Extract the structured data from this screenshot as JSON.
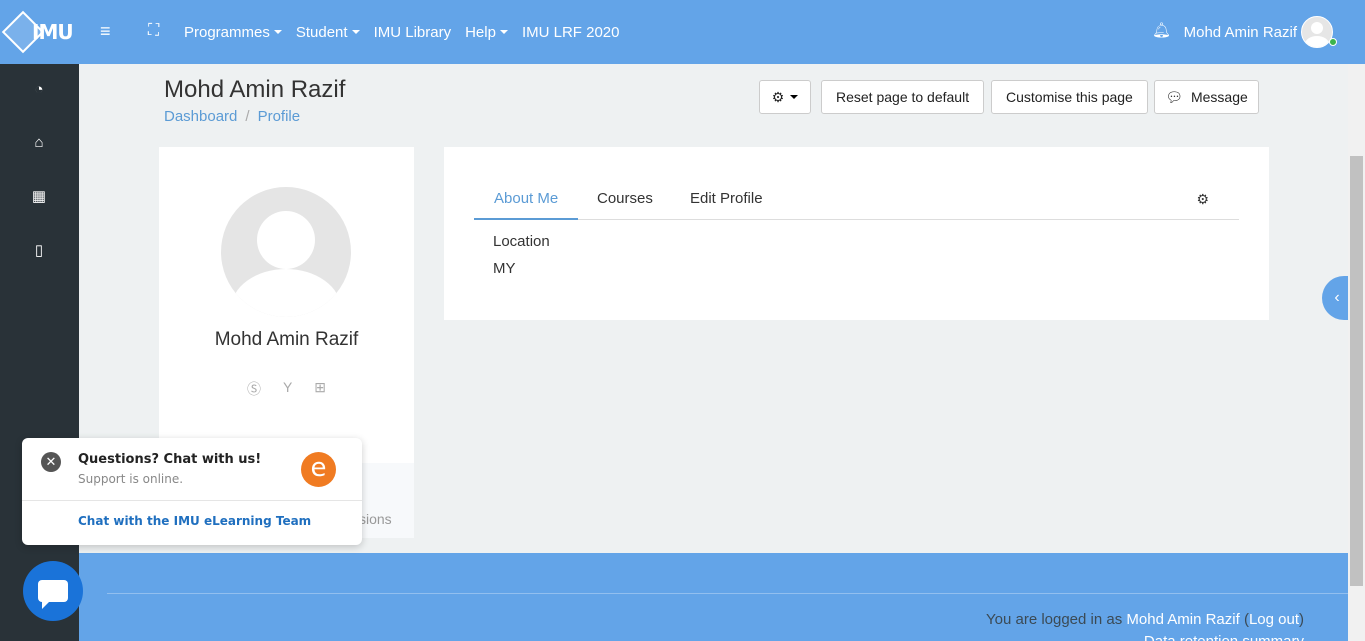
{
  "navbar": {
    "logo_text": "IMU",
    "menu": [
      "Programmes",
      "Student",
      "IMU Library",
      "Help",
      "IMU LRF 2020"
    ],
    "user_name": "Mohd Amin Razif"
  },
  "sidebar": {
    "icons": [
      "dashboard-icon",
      "home-icon",
      "calendar-icon",
      "file-icon"
    ]
  },
  "page": {
    "title": "Mohd Amin Razif",
    "breadcrumb": [
      "Dashboard",
      "Profile"
    ],
    "buttons": {
      "reset": "Reset page to default",
      "customise": "Customise this page",
      "message": "Message"
    }
  },
  "profile_card": {
    "name": "Mohd Amin Razif",
    "social_icons": [
      "skype-icon",
      "yahoo-icon",
      "windows-icon"
    ],
    "partial_text": "sions"
  },
  "tabs": [
    "About Me",
    "Courses",
    "Edit Profile"
  ],
  "about": {
    "label": "Location",
    "value": "MY"
  },
  "footer": {
    "logged_in_prefix": "You are logged in as ",
    "user": "Mohd Amin Razif",
    "logout": "Log out",
    "retention": "Data retention summary"
  },
  "chat": {
    "title": "Questions? Chat with us!",
    "status": "Support is online.",
    "link": "Chat with the IMU eLearning Team",
    "logo_letter": "e"
  },
  "colors": {
    "primary": "#63a4e8",
    "sidebar": "#293238",
    "link": "#5b9bd5",
    "chat_accent": "#f07b22"
  }
}
